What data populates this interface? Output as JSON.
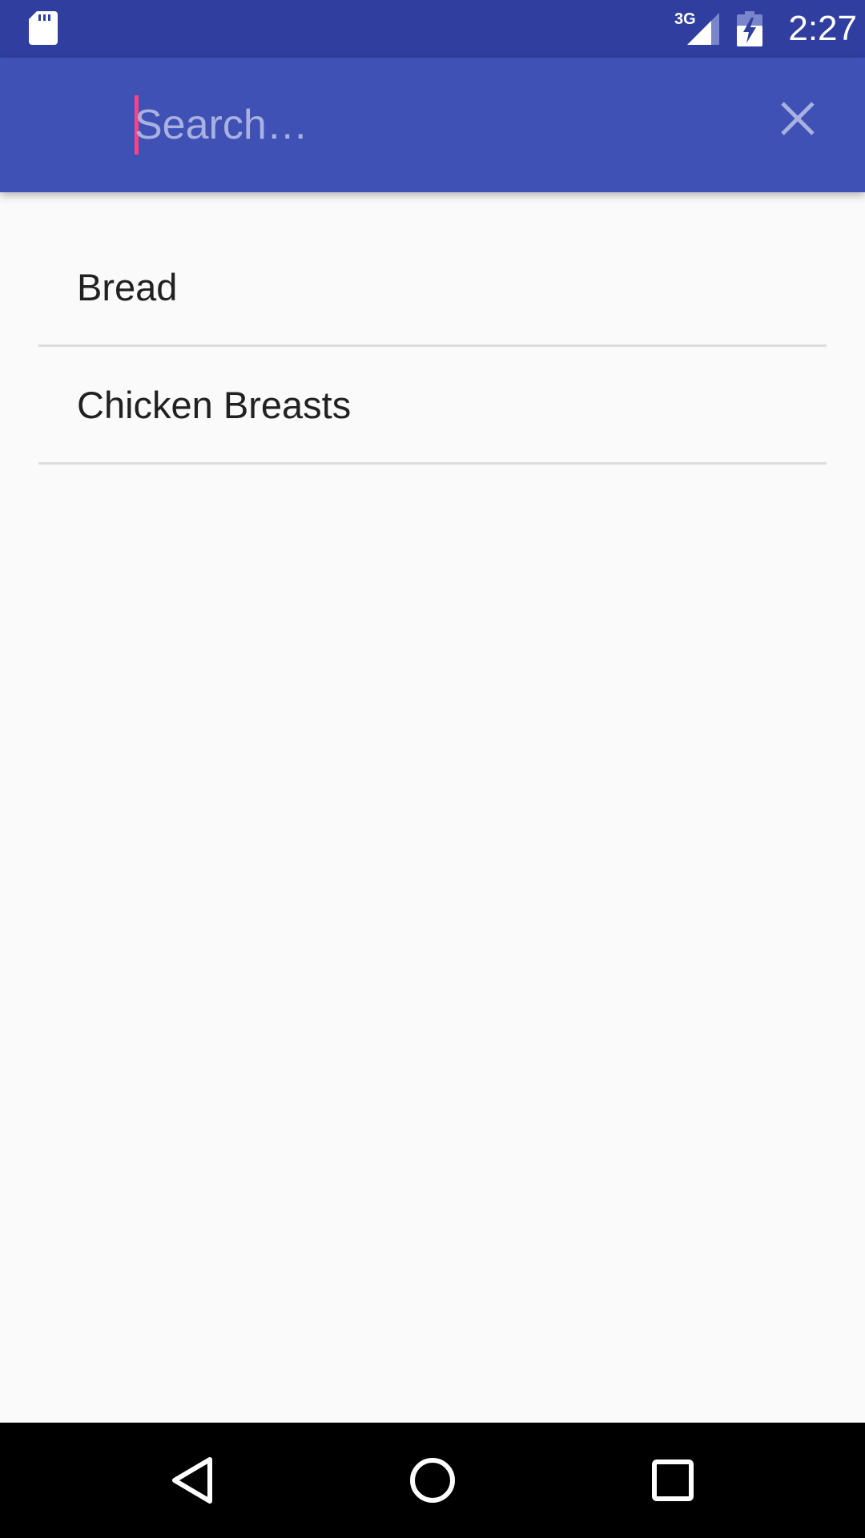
{
  "status_bar": {
    "time": "2:27",
    "network_label": "3G",
    "icons": [
      "sd-card-icon",
      "signal-3g-icon",
      "battery-charging-icon"
    ]
  },
  "toolbar": {
    "search": {
      "placeholder": "Search…",
      "value": ""
    },
    "clear_icon": "close-icon"
  },
  "list": {
    "items": [
      {
        "label": "Bread"
      },
      {
        "label": "Chicken Breasts"
      }
    ]
  },
  "nav_bar": {
    "icons": [
      "back-icon",
      "home-icon",
      "recents-icon"
    ]
  },
  "colors": {
    "status_bar": "#303f9f",
    "toolbar": "#3f51b5",
    "accent": "#ff4081",
    "background": "#fafafa",
    "divider": "#dcdcdc",
    "text_primary": "#212121"
  }
}
